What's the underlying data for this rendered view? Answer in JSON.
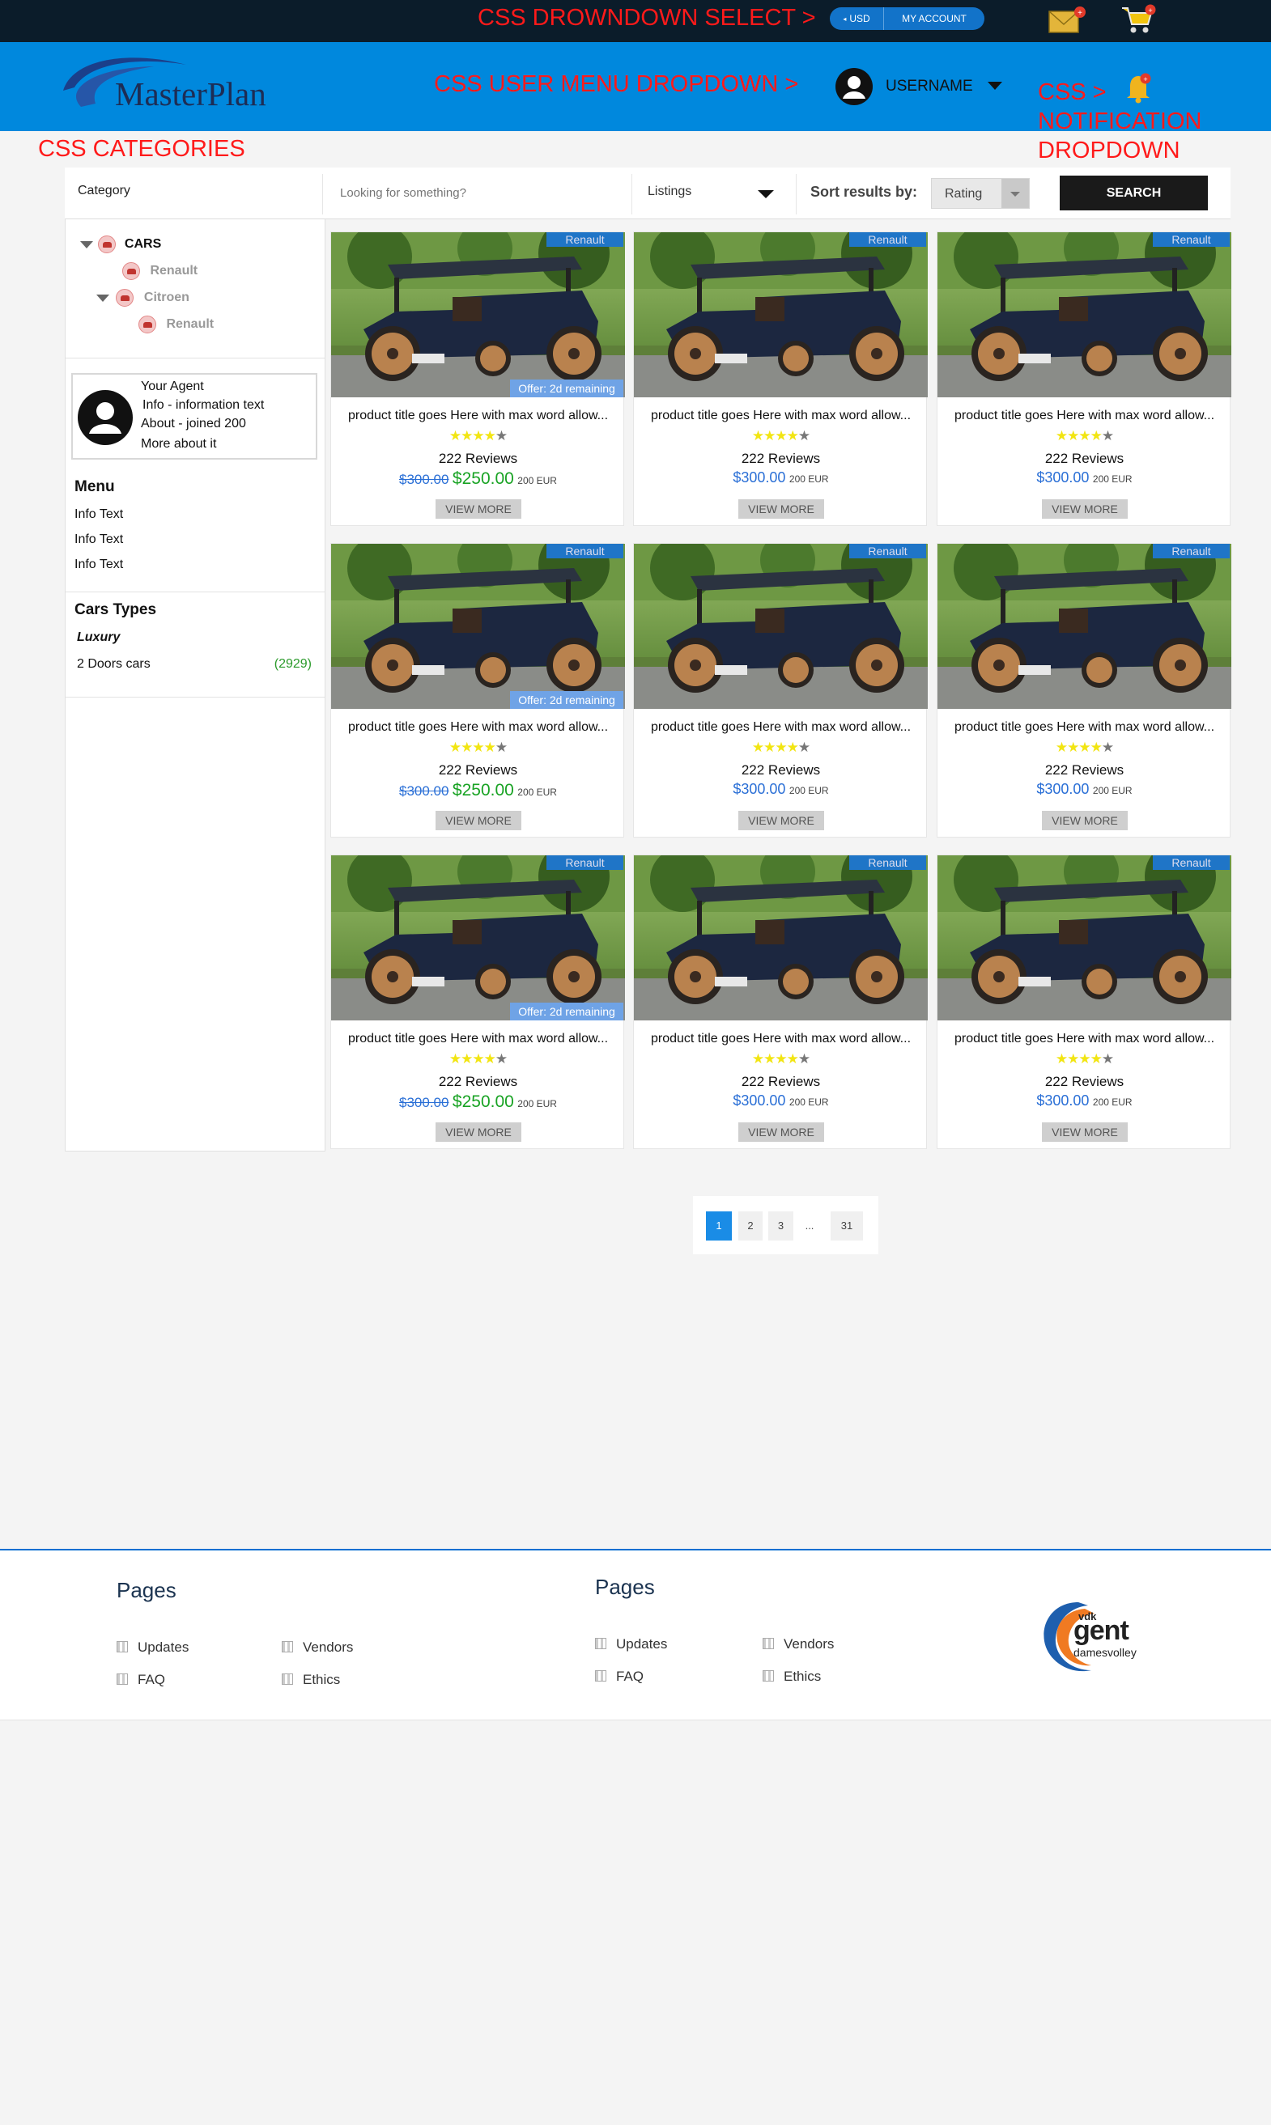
{
  "topbar": {
    "dropdown_annotation": "CSS DROWNDOWN SELECT >",
    "currency": "USD",
    "my_account": "MY ACCOUNT"
  },
  "header": {
    "logo": "MasterPlan",
    "user_menu_annotation": "CSS  USER MENU DROPDOWN >",
    "username": "USERNAME",
    "notification_annotation_1": "CSS  >",
    "notification_annotation_2": "NOTIFICATION",
    "notification_annotation_3": "DROPDOWN"
  },
  "categories_annotation": "CSS CATEGORIES",
  "search": {
    "category_label": "Category",
    "placeholder": "Looking for something?",
    "listings": "Listings",
    "sort_label": "Sort results by:",
    "sort_value": "Rating",
    "button": "SEARCH"
  },
  "sidebar": {
    "tree": {
      "root": "CARS",
      "child1": "Renault",
      "child2": "Citroen",
      "grandchild": "Renault"
    },
    "agent": {
      "line1": "Your Agent",
      "line2": "Info - information text",
      "line3": "About - joined 200",
      "line4": "More about it"
    },
    "menu": {
      "title": "Menu",
      "items": [
        "Info Text",
        "Info Text",
        "Info Text"
      ]
    },
    "types": {
      "title": "Cars Types",
      "subtitle": "Luxury",
      "item": "2 Doors cars",
      "count": "(2929)"
    }
  },
  "products": [
    {
      "brand": "Renault",
      "offer": "Offer: 2d remaining",
      "title": "product title goes Here with max word allow...",
      "reviews": "222 Reviews",
      "old_price": "$300.00",
      "price": "$250.00",
      "eur": "200 EUR",
      "button": "VIEW MORE",
      "rating": 4.5
    },
    {
      "brand": "Renault",
      "title": "product title goes Here with max word allow...",
      "reviews": "222 Reviews",
      "price": "$300.00",
      "eur": "200 EUR",
      "button": "VIEW MORE",
      "rating": 4.5
    },
    {
      "brand": "Renault",
      "title": "product title goes Here with max word allow...",
      "reviews": "222 Reviews",
      "price": "$300.00",
      "eur": "200 EUR",
      "button": "VIEW MORE",
      "rating": 4.5
    },
    {
      "brand": "Renault",
      "offer": "Offer: 2d remaining",
      "title": "product title goes Here with max word allow...",
      "reviews": "222 Reviews",
      "old_price": "$300.00",
      "price": "$250.00",
      "eur": "200 EUR",
      "button": "VIEW MORE",
      "rating": 4.5
    },
    {
      "brand": "Renault",
      "title": "product title goes Here with max word allow...",
      "reviews": "222 Reviews",
      "price": "$300.00",
      "eur": "200 EUR",
      "button": "VIEW MORE",
      "rating": 4.5
    },
    {
      "brand": "Renault",
      "title": "product title goes Here with max word allow...",
      "reviews": "222 Reviews",
      "price": "$300.00",
      "eur": "200 EUR",
      "button": "VIEW MORE",
      "rating": 4.5
    },
    {
      "brand": "Renault",
      "offer": "Offer: 2d remaining",
      "title": "product title goes Here with max word allow...",
      "reviews": "222 Reviews",
      "old_price": "$300.00",
      "price": "$250.00",
      "eur": "200 EUR",
      "button": "VIEW MORE",
      "rating": 4.5
    },
    {
      "brand": "Renault",
      "title": "product title goes Here with max word allow...",
      "reviews": "222 Reviews",
      "price": "$300.00",
      "eur": "200 EUR",
      "button": "VIEW MORE",
      "rating": 4.5
    },
    {
      "brand": "Renault",
      "title": "product title goes Here with max word allow...",
      "reviews": "222 Reviews",
      "price": "$300.00",
      "eur": "200 EUR",
      "button": "VIEW MORE",
      "rating": 4.5
    }
  ],
  "pagination": [
    "1",
    "2",
    "3",
    "...",
    "31"
  ],
  "pagination_active": "1",
  "footer": {
    "col1": {
      "title": "Pages",
      "links": [
        "Updates",
        "Vendors",
        "FAQ",
        "Ethics"
      ]
    },
    "col2": {
      "title": "Pages",
      "links": [
        "Updates",
        "Vendors",
        "FAQ",
        "Ethics"
      ]
    },
    "logo_small": "vdk",
    "logo_main": "gent",
    "logo_sub": "damesvolley"
  },
  "colors": {
    "header": "#0088dd",
    "topbar": "#0b1c2a",
    "accent_red": "#ff1a1a",
    "active_page": "#1a8ce6",
    "price_green": "#19a324"
  }
}
